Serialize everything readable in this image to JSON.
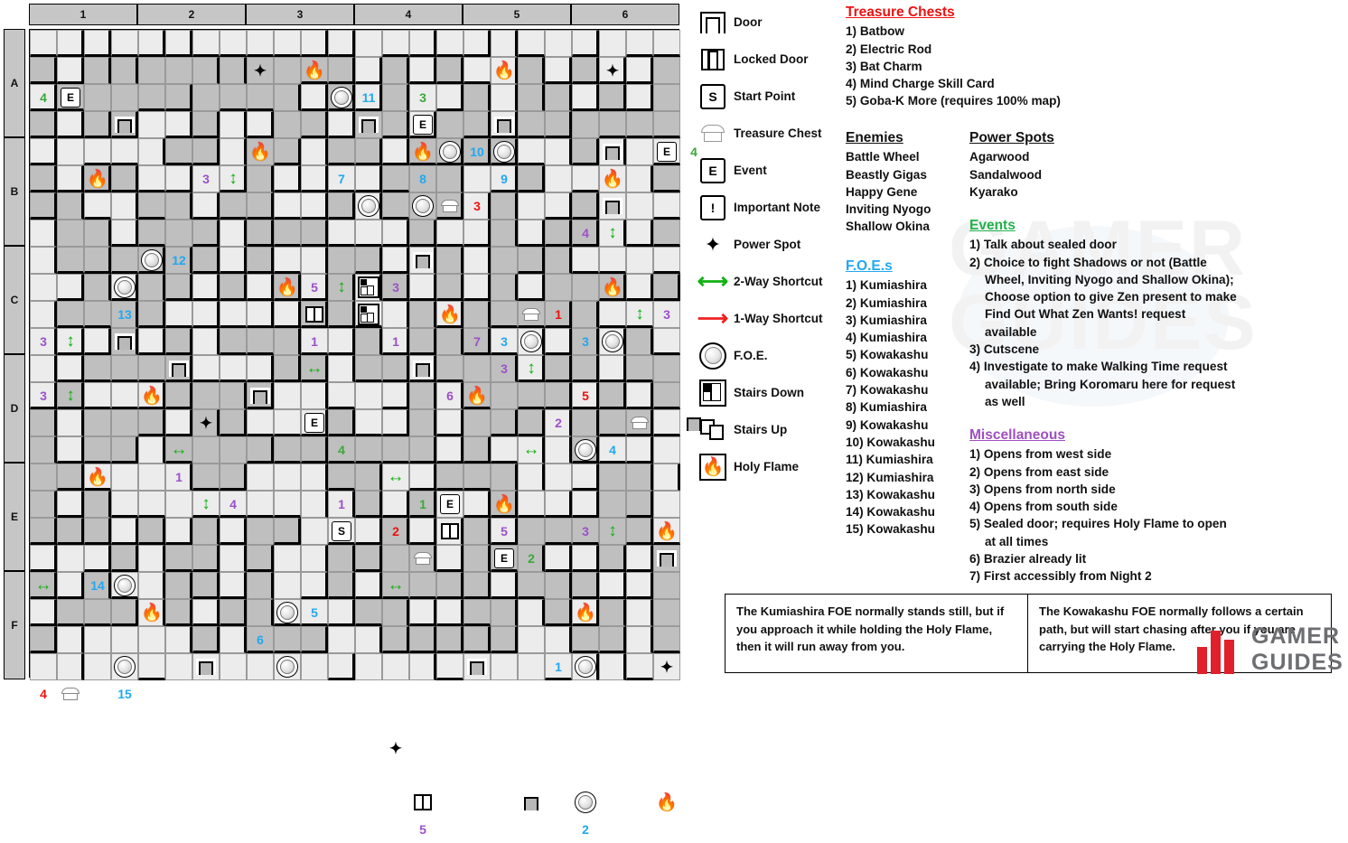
{
  "map": {
    "col_headers": [
      "1",
      "2",
      "3",
      "4",
      "5",
      "6"
    ],
    "row_headers": [
      "A",
      "B",
      "C",
      "D",
      "E",
      "F"
    ],
    "cols": 24,
    "rows": 24,
    "colors": {
      "floor_light": "#ececec",
      "floor_dark": "#bfbfbf",
      "wall": "#000000",
      "header": "#c6c6c6",
      "blue": "#22a8f0",
      "red": "#ee1111",
      "purple": "#9b51c9",
      "green": "#3aa93a",
      "flame": "#f4641e"
    },
    "markers": [
      {
        "c": 0,
        "r": 2,
        "t": "num",
        "v": "4",
        "k": "green"
      },
      {
        "c": 1,
        "r": 2,
        "t": "event",
        "v": "E"
      },
      {
        "c": 8,
        "r": 1,
        "t": "star"
      },
      {
        "c": 10,
        "r": 1,
        "t": "flame"
      },
      {
        "c": 11,
        "r": 2,
        "t": "foe"
      },
      {
        "c": 12,
        "r": 2,
        "t": "num",
        "v": "11",
        "k": "blue"
      },
      {
        "c": 3,
        "r": 3,
        "t": "door"
      },
      {
        "c": 8,
        "r": 4,
        "t": "flame"
      },
      {
        "c": 17,
        "r": 1,
        "t": "flame"
      },
      {
        "c": 21,
        "r": 1,
        "t": "star"
      },
      {
        "c": 14,
        "r": 2,
        "t": "num",
        "v": "3",
        "k": "green"
      },
      {
        "c": 14,
        "r": 3,
        "t": "event",
        "v": "E"
      },
      {
        "c": 12,
        "r": 3,
        "t": "door"
      },
      {
        "c": 17,
        "r": 3,
        "t": "door"
      },
      {
        "c": 21,
        "r": 4,
        "t": "door"
      },
      {
        "c": 2,
        "r": 5,
        "t": "flame"
      },
      {
        "c": 14,
        "r": 4,
        "t": "flame"
      },
      {
        "c": 15,
        "r": 4,
        "t": "foe"
      },
      {
        "c": 16,
        "r": 4,
        "t": "num",
        "v": "10",
        "k": "blue"
      },
      {
        "c": 17,
        "r": 4,
        "t": "foe"
      },
      {
        "c": 23,
        "r": 4,
        "t": "event",
        "v": "E"
      },
      {
        "c": 24,
        "r": 4,
        "t": "num",
        "v": "4",
        "k": "green"
      },
      {
        "c": 6,
        "r": 5,
        "t": "num",
        "v": "3",
        "k": "purple"
      },
      {
        "c": 7,
        "r": 5,
        "t": "arrowV"
      },
      {
        "c": 11,
        "r": 5,
        "t": "num",
        "v": "7",
        "k": "blue"
      },
      {
        "c": 14,
        "r": 5,
        "t": "num",
        "v": "8",
        "k": "blue"
      },
      {
        "c": 17,
        "r": 5,
        "t": "num",
        "v": "9",
        "k": "blue"
      },
      {
        "c": 21,
        "r": 5,
        "t": "flame"
      },
      {
        "c": 12,
        "r": 6,
        "t": "foe"
      },
      {
        "c": 14,
        "r": 6,
        "t": "foe"
      },
      {
        "c": 15,
        "r": 6,
        "t": "chest"
      },
      {
        "c": 16,
        "r": 6,
        "t": "num",
        "v": "3",
        "k": "red"
      },
      {
        "c": 21,
        "r": 6,
        "t": "door"
      },
      {
        "c": 20,
        "r": 7,
        "t": "num",
        "v": "4",
        "k": "purple"
      },
      {
        "c": 21,
        "r": 7,
        "t": "arrowV"
      },
      {
        "c": 4,
        "r": 8,
        "t": "foe"
      },
      {
        "c": 5,
        "r": 8,
        "t": "num",
        "v": "12",
        "k": "blue"
      },
      {
        "c": 14,
        "r": 8,
        "t": "door"
      },
      {
        "c": 3,
        "r": 9,
        "t": "foe"
      },
      {
        "c": 9,
        "r": 9,
        "t": "flame"
      },
      {
        "c": 10,
        "r": 9,
        "t": "num",
        "v": "5",
        "k": "purple"
      },
      {
        "c": 11,
        "r": 9,
        "t": "arrowV"
      },
      {
        "c": 12,
        "r": 9,
        "t": "stairsD"
      },
      {
        "c": 13,
        "r": 9,
        "t": "num",
        "v": "3",
        "k": "purple"
      },
      {
        "c": 21,
        "r": 9,
        "t": "flame"
      },
      {
        "c": 3,
        "r": 10,
        "t": "num",
        "v": "13",
        "k": "blue"
      },
      {
        "c": 10,
        "r": 10,
        "t": "lock"
      },
      {
        "c": 12,
        "r": 10,
        "t": "stairsD"
      },
      {
        "c": 15,
        "r": 10,
        "t": "flame"
      },
      {
        "c": 18,
        "r": 10,
        "t": "chest"
      },
      {
        "c": 19,
        "r": 10,
        "t": "num",
        "v": "1",
        "k": "red"
      },
      {
        "c": 22,
        "r": 10,
        "t": "arrowV"
      },
      {
        "c": 23,
        "r": 10,
        "t": "num",
        "v": "3",
        "k": "purple"
      },
      {
        "c": 0,
        "r": 11,
        "t": "num",
        "v": "3",
        "k": "purple"
      },
      {
        "c": 1,
        "r": 11,
        "t": "arrowV"
      },
      {
        "c": 10,
        "r": 11,
        "t": "num",
        "v": "1",
        "k": "purple"
      },
      {
        "c": 13,
        "r": 11,
        "t": "num",
        "v": "1",
        "k": "purple"
      },
      {
        "c": 16,
        "r": 11,
        "t": "num",
        "v": "7",
        "k": "purple"
      },
      {
        "c": 17,
        "r": 11,
        "t": "num",
        "v": "3",
        "k": "blue"
      },
      {
        "c": 18,
        "r": 11,
        "t": "foe"
      },
      {
        "c": 20,
        "r": 11,
        "t": "num",
        "v": "3",
        "k": "blue"
      },
      {
        "c": 21,
        "r": 11,
        "t": "foe"
      },
      {
        "c": 3,
        "r": 11,
        "t": "door"
      },
      {
        "c": 5,
        "r": 12,
        "t": "door"
      },
      {
        "c": 10,
        "r": 12,
        "t": "arrowH"
      },
      {
        "c": 14,
        "r": 12,
        "t": "door"
      },
      {
        "c": 17,
        "r": 12,
        "t": "num",
        "v": "3",
        "k": "purple"
      },
      {
        "c": 18,
        "r": 12,
        "t": "arrowV"
      },
      {
        "c": 0,
        "r": 13,
        "t": "num",
        "v": "3",
        "k": "purple"
      },
      {
        "c": 1,
        "r": 13,
        "t": "arrowV"
      },
      {
        "c": 4,
        "r": 13,
        "t": "flame"
      },
      {
        "c": 8,
        "r": 13,
        "t": "door"
      },
      {
        "c": 15,
        "r": 13,
        "t": "num",
        "v": "6",
        "k": "purple"
      },
      {
        "c": 16,
        "r": 13,
        "t": "flame"
      },
      {
        "c": 20,
        "r": 13,
        "t": "num",
        "v": "5",
        "k": "red"
      },
      {
        "c": 6,
        "r": 14,
        "t": "star"
      },
      {
        "c": 10,
        "r": 14,
        "t": "event",
        "v": "E"
      },
      {
        "c": 19,
        "r": 14,
        "t": "num",
        "v": "2",
        "k": "purple"
      },
      {
        "c": 22,
        "r": 14,
        "t": "chest"
      },
      {
        "c": 24,
        "r": 14,
        "t": "door"
      },
      {
        "c": 5,
        "r": 15,
        "t": "arrowH"
      },
      {
        "c": 11,
        "r": 15,
        "t": "num",
        "v": "4",
        "k": "green"
      },
      {
        "c": 18,
        "r": 15,
        "t": "arrowH"
      },
      {
        "c": 20,
        "r": 15,
        "t": "foe"
      },
      {
        "c": 21,
        "r": 15,
        "t": "num",
        "v": "4",
        "k": "blue"
      },
      {
        "c": 2,
        "r": 16,
        "t": "flame"
      },
      {
        "c": 5,
        "r": 16,
        "t": "num",
        "v": "1",
        "k": "purple"
      },
      {
        "c": 13,
        "r": 16,
        "t": "arrowH"
      },
      {
        "c": 6,
        "r": 17,
        "t": "arrowV"
      },
      {
        "c": 7,
        "r": 17,
        "t": "num",
        "v": "4",
        "k": "purple"
      },
      {
        "c": 11,
        "r": 17,
        "t": "num",
        "v": "1",
        "k": "purple"
      },
      {
        "c": 14,
        "r": 17,
        "t": "num",
        "v": "1",
        "k": "green"
      },
      {
        "c": 15,
        "r": 17,
        "t": "event",
        "v": "E"
      },
      {
        "c": 17,
        "r": 17,
        "t": "flame"
      },
      {
        "c": 13,
        "r": 18,
        "t": "num",
        "v": "2",
        "k": "red"
      },
      {
        "c": 15,
        "r": 18,
        "t": "lock"
      },
      {
        "c": 17,
        "r": 18,
        "t": "num",
        "v": "5",
        "k": "purple"
      },
      {
        "c": 20,
        "r": 18,
        "t": "num",
        "v": "3",
        "k": "purple"
      },
      {
        "c": 21,
        "r": 18,
        "t": "arrowV"
      },
      {
        "c": 23,
        "r": 18,
        "t": "flame"
      },
      {
        "c": 11,
        "r": 18,
        "t": "start",
        "v": "S"
      },
      {
        "c": 14,
        "r": 19,
        "t": "chest"
      },
      {
        "c": 17,
        "r": 19,
        "t": "event",
        "v": "E"
      },
      {
        "c": 18,
        "r": 19,
        "t": "num",
        "v": "2",
        "k": "green"
      },
      {
        "c": 23,
        "r": 19,
        "t": "door"
      },
      {
        "c": 0,
        "r": 20,
        "t": "arrowH"
      },
      {
        "c": 2,
        "r": 20,
        "t": "num",
        "v": "14",
        "k": "blue"
      },
      {
        "c": 3,
        "r": 20,
        "t": "foe"
      },
      {
        "c": 13,
        "r": 20,
        "t": "arrowH"
      },
      {
        "c": 4,
        "r": 21,
        "t": "flame"
      },
      {
        "c": 9,
        "r": 21,
        "t": "foe"
      },
      {
        "c": 10,
        "r": 21,
        "t": "num",
        "v": "5",
        "k": "blue"
      },
      {
        "c": 20,
        "r": 21,
        "t": "flame"
      },
      {
        "c": 8,
        "r": 22,
        "t": "num",
        "v": "6",
        "k": "blue"
      },
      {
        "c": 3,
        "r": 23,
        "t": "foe"
      },
      {
        "c": 6,
        "r": 23,
        "t": "door"
      },
      {
        "c": 9,
        "r": 23,
        "t": "foe"
      },
      {
        "c": 16,
        "r": 23,
        "t": "door"
      },
      {
        "c": 19,
        "r": 23,
        "t": "num",
        "v": "1",
        "k": "blue"
      },
      {
        "c": 20,
        "r": 23,
        "t": "foe"
      },
      {
        "c": 23,
        "r": 23,
        "t": "star"
      },
      {
        "c": 0,
        "r": 24,
        "t": "num",
        "v": "4",
        "k": "red"
      },
      {
        "c": 1,
        "r": 24,
        "t": "chest"
      },
      {
        "c": 3,
        "r": 24,
        "t": "num",
        "v": "15",
        "k": "blue"
      },
      {
        "c": 13,
        "r": 26,
        "t": "star"
      },
      {
        "c": 14,
        "r": 28,
        "t": "lock"
      },
      {
        "c": 18,
        "r": 28,
        "t": "door"
      },
      {
        "c": 20,
        "r": 28,
        "t": "foe"
      },
      {
        "c": 23,
        "r": 28,
        "t": "flame"
      },
      {
        "c": 14,
        "r": 29,
        "t": "num",
        "v": "5",
        "k": "purple"
      },
      {
        "c": 20,
        "r": 29,
        "t": "num",
        "v": "2",
        "k": "blue"
      }
    ]
  },
  "legend": {
    "items": [
      {
        "icon": "door-icon",
        "label": "Door"
      },
      {
        "icon": "locked-door-icon",
        "label": "Locked Door"
      },
      {
        "icon": "start-point-icon",
        "label": "Start Point"
      },
      {
        "icon": "treasure-chest-icon",
        "label": "Treasure Chest"
      },
      {
        "icon": "event-icon",
        "label": "Event"
      },
      {
        "icon": "important-note-icon",
        "label": "Important Note"
      },
      {
        "icon": "power-spot-icon",
        "label": "Power Spot"
      },
      {
        "icon": "two-way-shortcut-icon",
        "label": "2-Way Shortcut"
      },
      {
        "icon": "one-way-shortcut-icon",
        "label": "1-Way Shortcut"
      },
      {
        "icon": "foe-icon",
        "label": "F.O.E."
      },
      {
        "icon": "stairs-down-icon",
        "label": "Stairs Down"
      },
      {
        "icon": "stairs-up-icon",
        "label": "Stairs Up"
      },
      {
        "icon": "holy-flame-icon",
        "label": "Holy Flame"
      }
    ],
    "start_point_glyph": "S",
    "event_glyph": "E",
    "important_note_glyph": "!"
  },
  "treasure_chests": {
    "title": "Treasure Chests",
    "items": [
      "1) Batbow",
      "2) Electric Rod",
      "3) Bat Charm",
      "4) Mind Charge Skill Card",
      "5) Goba-K More (requires 100% map)"
    ]
  },
  "enemies": {
    "title": "Enemies",
    "items": [
      "Battle Wheel",
      "Beastly Gigas",
      "Happy Gene",
      "Inviting Nyogo",
      "Shallow Okina"
    ]
  },
  "power_spots": {
    "title": "Power Spots",
    "items": [
      "Agarwood",
      "Sandalwood",
      "Kyarako"
    ]
  },
  "foes": {
    "title": "F.O.E.s",
    "items": [
      "1) Kumiashira",
      "2) Kumiashira",
      "3) Kumiashira",
      "4) Kumiashira",
      "5) Kowakashu",
      "6) Kowakashu",
      "7) Kowakashu",
      "8) Kumiashira",
      "9) Kowakashu",
      "10) Kowakashu",
      "11) Kumiashira",
      "12) Kumiashira",
      "13) Kowakashu",
      "14) Kowakashu",
      "15) Kowakashu"
    ]
  },
  "events": {
    "title": "Events",
    "items": [
      {
        "num": "1)",
        "lines": [
          "Talk about sealed door"
        ]
      },
      {
        "num": "2)",
        "lines": [
          "Choice to fight Shadows or not (Battle",
          "Wheel, Inviting Nyogo and Shallow Okina);",
          "Choose option to give Zen present to make",
          "Find Out What Zen Wants! request",
          "available"
        ]
      },
      {
        "num": "3)",
        "lines": [
          "Cutscene"
        ]
      },
      {
        "num": "4)",
        "lines": [
          "Investigate to make Walking Time request",
          "available; Bring Koromaru here for request",
          "as well"
        ]
      }
    ]
  },
  "miscellaneous": {
    "title": "Miscellaneous",
    "items": [
      {
        "num": "1)",
        "lines": [
          "Opens from west side"
        ]
      },
      {
        "num": "2)",
        "lines": [
          "Opens from east side"
        ]
      },
      {
        "num": "3)",
        "lines": [
          "Opens from north side"
        ]
      },
      {
        "num": "4)",
        "lines": [
          "Opens from south side"
        ]
      },
      {
        "num": "5)",
        "lines": [
          "Sealed door; requires Holy Flame to open",
          "at all times"
        ]
      },
      {
        "num": "6)",
        "lines": [
          "Brazier already lit"
        ]
      },
      {
        "num": "7)",
        "lines": [
          "First accessibly from Night 2"
        ]
      }
    ]
  },
  "notes": {
    "left": "The Kumiashira FOE normally stands still, but if you approach it while holding the Holy Flame, then it will run away from you.",
    "right": "The Kowakashu FOE normally follows a certain path, but will start chasing after you if you are carrying the Holy Flame."
  },
  "branding": {
    "line1": "GAMER",
    "line2": "GUIDES",
    "watermark": "GAMER GUIDES"
  }
}
